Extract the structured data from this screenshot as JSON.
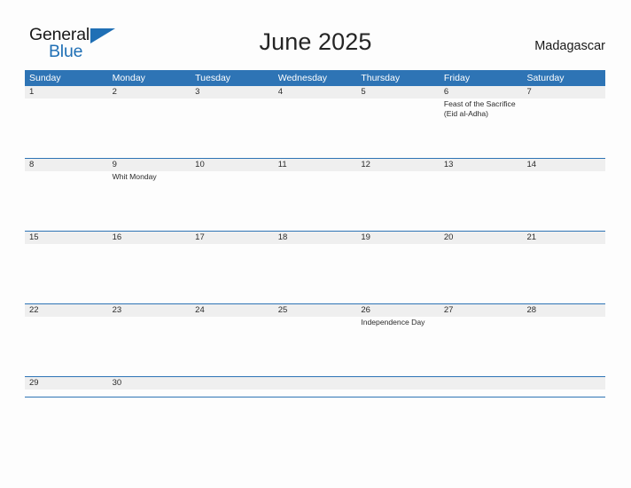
{
  "brand": {
    "name_part1": "General",
    "name_part2": "Blue",
    "accent_color": "#1F6FB5"
  },
  "header": {
    "title": "June 2025",
    "region": "Madagascar"
  },
  "calendar": {
    "header_bg": "#2E74B5",
    "band_bg": "#EFEFEF",
    "weekday_headers": [
      "Sunday",
      "Monday",
      "Tuesday",
      "Wednesday",
      "Thursday",
      "Friday",
      "Saturday"
    ],
    "weeks": [
      {
        "days": [
          {
            "num": "1",
            "events": []
          },
          {
            "num": "2",
            "events": []
          },
          {
            "num": "3",
            "events": []
          },
          {
            "num": "4",
            "events": []
          },
          {
            "num": "5",
            "events": []
          },
          {
            "num": "6",
            "events": [
              "Feast of the Sacrifice (Eid al-Adha)"
            ]
          },
          {
            "num": "7",
            "events": []
          }
        ]
      },
      {
        "days": [
          {
            "num": "8",
            "events": []
          },
          {
            "num": "9",
            "events": [
              "Whit Monday"
            ]
          },
          {
            "num": "10",
            "events": []
          },
          {
            "num": "11",
            "events": []
          },
          {
            "num": "12",
            "events": []
          },
          {
            "num": "13",
            "events": []
          },
          {
            "num": "14",
            "events": []
          }
        ]
      },
      {
        "days": [
          {
            "num": "15",
            "events": []
          },
          {
            "num": "16",
            "events": []
          },
          {
            "num": "17",
            "events": []
          },
          {
            "num": "18",
            "events": []
          },
          {
            "num": "19",
            "events": []
          },
          {
            "num": "20",
            "events": []
          },
          {
            "num": "21",
            "events": []
          }
        ]
      },
      {
        "days": [
          {
            "num": "22",
            "events": []
          },
          {
            "num": "23",
            "events": []
          },
          {
            "num": "24",
            "events": []
          },
          {
            "num": "25",
            "events": []
          },
          {
            "num": "26",
            "events": [
              "Independence Day"
            ]
          },
          {
            "num": "27",
            "events": []
          },
          {
            "num": "28",
            "events": []
          }
        ]
      },
      {
        "last": true,
        "days": [
          {
            "num": "29",
            "events": []
          },
          {
            "num": "30",
            "events": []
          },
          {
            "num": "",
            "events": []
          },
          {
            "num": "",
            "events": []
          },
          {
            "num": "",
            "events": []
          },
          {
            "num": "",
            "events": []
          },
          {
            "num": "",
            "events": []
          }
        ]
      }
    ]
  }
}
